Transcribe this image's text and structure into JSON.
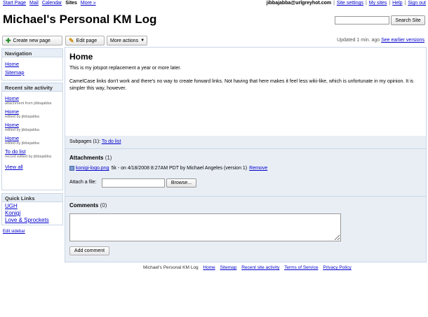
{
  "topnav": {
    "items": [
      "Start Page",
      "Mail",
      "Calendar",
      "Sites",
      "More »"
    ]
  },
  "userbar": {
    "email": "jibbajabba@urlgreyhot.com",
    "links": [
      "Site settings",
      "My sites",
      "Help",
      "Sign out"
    ]
  },
  "site_title": "Michael's Personal KM Log",
  "search": {
    "button": "Search Site",
    "placeholder": ""
  },
  "toolbar": {
    "create": "Create new page",
    "edit": "Edit page",
    "more": "More actions",
    "updated": "Updated 1 min. ago",
    "earlier": "See earlier versions"
  },
  "sidebar": {
    "navigation": {
      "title": "Navigation",
      "items": [
        "Home",
        "Sitemap"
      ]
    },
    "recent": {
      "title": "Recent site activity",
      "items": [
        {
          "label": "Home",
          "sub": "attachment from jibbajabba"
        },
        {
          "label": "Home",
          "sub": "edited by jibbajabba"
        },
        {
          "label": "Home",
          "sub": "edited by jibbajabba"
        },
        {
          "label": "Home",
          "sub": "edited by jibbajabba"
        },
        {
          "label": "To do list",
          "sub": "record edited by jibbajabba"
        }
      ],
      "view_all": "View all"
    },
    "quick": {
      "title": "Quick Links",
      "items": [
        "UGH",
        "Konigi",
        "Love & Sprockets"
      ]
    },
    "edit_sidebar": "Edit sidebar"
  },
  "page": {
    "title": "Home",
    "p1": "This is my jotspot replacement a year or more later.",
    "p2": "CamelCase links don't work and there's no  way to create forward links. Not having that here makes it feel less wiki-like, which is unfortunate in my opinion. It is simpler this way, however."
  },
  "subpages": {
    "label": "Subpages (1):",
    "link": "To do list"
  },
  "attachments": {
    "title": "Attachments",
    "count": "(1)",
    "file": "konigi-logo.png",
    "meta": "5k - on 4/18/2008 8:27AM PDT by Michael Angeles (version 1)",
    "remove": "Remove",
    "attach_label": "Attach a file:",
    "browse": "Browse..."
  },
  "comments": {
    "title": "Comments",
    "count": "(0)",
    "button": "Add comment"
  },
  "footer": {
    "site": "Michael's Personal KM Log",
    "links": [
      "Home",
      "Sitemap",
      "Recent site activity",
      "Terms of Service",
      "Privacy Policy"
    ]
  }
}
